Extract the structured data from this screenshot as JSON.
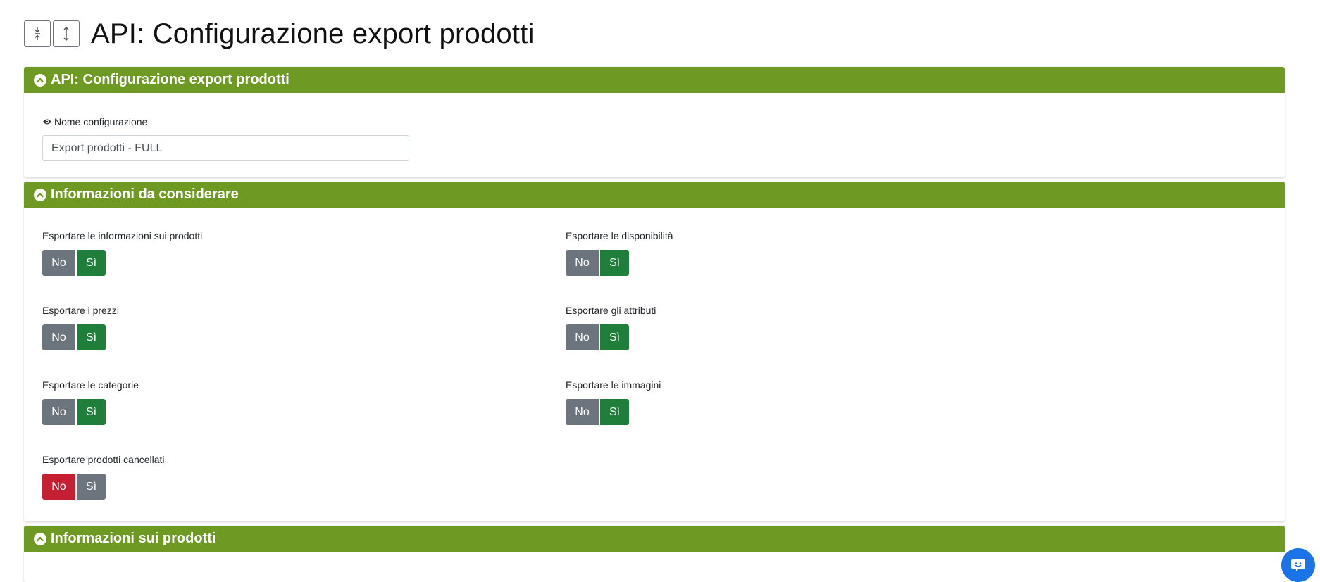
{
  "page_title": "API: Configurazione export prodotti",
  "icons": {
    "collapse_all": "compress-vertical-icon",
    "expand_all": "expand-vertical-icon",
    "section_toggle": "chevron-up-circle-icon",
    "visibility": "eye-icon",
    "chat": "chat-support-icon"
  },
  "colors": {
    "section_header": "#6e9a24",
    "active_yes": "#1f7f3a",
    "active_no": "#c51f34",
    "inactive": "#6c757d",
    "chat_button": "#1a73e8"
  },
  "sections": {
    "config": {
      "title": "API: Configurazione export prodotti",
      "name_label": "Nome configurazione",
      "name_value": "Export prodotti - FULL"
    },
    "info": {
      "title": "Informazioni da considerare",
      "toggles": [
        {
          "label": "Esportare le informazioni sui prodotti",
          "no": "No",
          "yes": "Sì",
          "selected": "yes"
        },
        {
          "label": "Esportare le disponibilità",
          "no": "No",
          "yes": "Sì",
          "selected": "yes"
        },
        {
          "label": "Esportare i prezzi",
          "no": "No",
          "yes": "Sì",
          "selected": "yes"
        },
        {
          "label": "Esportare gli attributi",
          "no": "No",
          "yes": "Sì",
          "selected": "yes"
        },
        {
          "label": "Esportare le categorie",
          "no": "No",
          "yes": "Sì",
          "selected": "yes"
        },
        {
          "label": "Esportare le immagini",
          "no": "No",
          "yes": "Sì",
          "selected": "yes"
        },
        {
          "label": "Esportare prodotti cancellati",
          "no": "No",
          "yes": "Sì",
          "selected": "no"
        }
      ]
    },
    "products": {
      "title": "Informazioni sui prodotti"
    }
  }
}
